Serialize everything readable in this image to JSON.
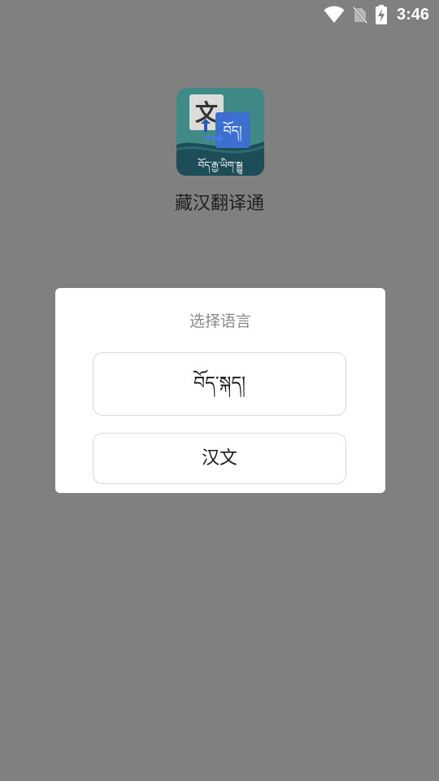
{
  "status_bar": {
    "time": "3:46",
    "icons": [
      "wifi-icon",
      "no-sim-icon",
      "battery-charging-icon"
    ]
  },
  "app": {
    "name": "藏汉翻译通",
    "icon": {
      "name": "translate-app-icon",
      "glyph_chinese": "文",
      "glyph_tibetan": "བོད།",
      "footer_text": "བོད་རྒྱ་ཡིག་སྒྱུ"
    }
  },
  "dialog": {
    "title": "选择语言",
    "options": [
      {
        "label": "བོད་སྐད།"
      },
      {
        "label": "汉文"
      }
    ]
  },
  "colors": {
    "overlay": "#808080",
    "dialog_bg": "#ffffff",
    "title_gray": "#8a8a8a",
    "button_border": "#d9d9d9",
    "icon_teal": "#3f8a86",
    "icon_blue": "#3d6fd0"
  }
}
